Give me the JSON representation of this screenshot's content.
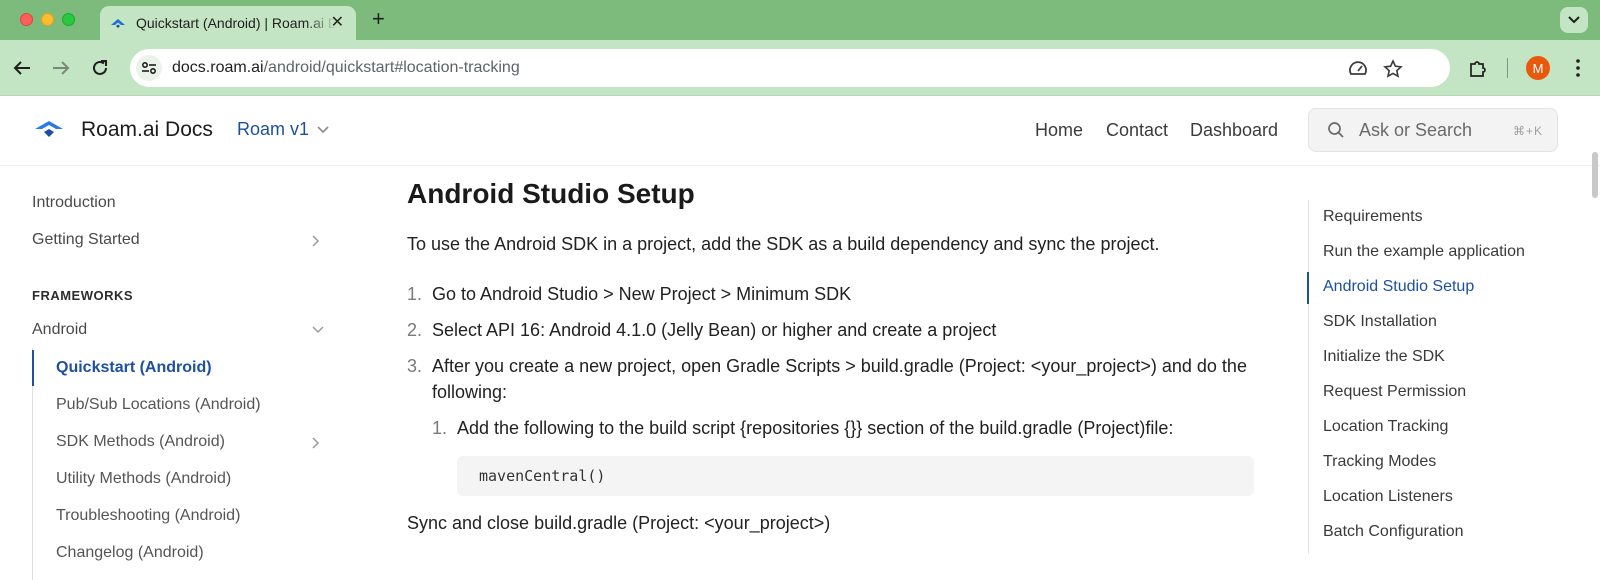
{
  "browser": {
    "tab_title": "Quickstart (Android) | Roam.ai Docs",
    "url_host": "docs.roam.ai",
    "url_path": "/android/quickstart#location-tracking",
    "profile_initial": "M"
  },
  "header": {
    "site_name": "Roam.ai Docs",
    "version": "Roam v1",
    "nav": [
      "Home",
      "Contact",
      "Dashboard"
    ],
    "search_placeholder": "Ask or Search",
    "search_shortcut": "⌘+K"
  },
  "sidebar": {
    "top_items": [
      "Introduction",
      "Getting Started"
    ],
    "section_label": "FRAMEWORKS",
    "framework": "Android",
    "sub_items": [
      "Quickstart (Android)",
      "Pub/Sub Locations (Android)",
      "SDK Methods (Android)",
      "Utility Methods (Android)",
      "Troubleshooting (Android)",
      "Changelog (Android)"
    ],
    "active_sub_item": "Quickstart (Android)"
  },
  "content": {
    "heading": "Android Studio Setup",
    "intro": "To use the Android SDK in a project, add the SDK as a build dependency and sync the project.",
    "steps": [
      {
        "num": "1.",
        "text": "Go to Android Studio > New Project > Minimum SDK"
      },
      {
        "num": "2.",
        "text": "Select API 16: Android 4.1.0 (Jelly Bean) or higher and create a project"
      },
      {
        "num": "3.",
        "text": "After you create a new project, open Gradle Scripts > build.gradle (Project: <your_project>) and do the following:"
      }
    ],
    "sub_step": {
      "num": "1.",
      "text": "Add the following to the build script {repositories {}} section of the build.gradle (Project)file:"
    },
    "code": "mavenCentral()",
    "closing": "Sync and close build.gradle (Project: <your_project>)"
  },
  "toc": {
    "items": [
      "Requirements",
      "Run the example application",
      "Android Studio Setup",
      "SDK Installation",
      "Initialize the SDK",
      "Request Permission",
      "Location Tracking",
      "Tracking Modes",
      "Location Listeners",
      "Batch Configuration"
    ],
    "active": "Android Studio Setup"
  },
  "colors": {
    "accent": "#1e4fa0",
    "browser_frame": "#7cbb7c",
    "browser_toolbar": "#c3e5c3"
  }
}
